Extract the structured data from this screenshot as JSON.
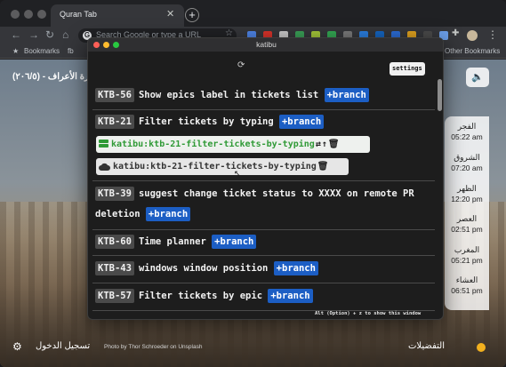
{
  "browser": {
    "tab_title": "Quran Tab",
    "tab_close": "✕",
    "new_tab": "+",
    "omnibox_placeholder": "Search Google or type a URL",
    "omnibox_logo": "G",
    "bookmarks_bar": {
      "label": "Bookmarks",
      "item_short": "fb",
      "other": "Other Bookmarks"
    },
    "nav": {
      "back": "←",
      "forward": "→",
      "reload": "↻",
      "home": "⌂",
      "star": "☆",
      "extensions": "puzzle-icon",
      "menu": "⋮"
    }
  },
  "quran_page": {
    "surah_title": "سورة الأعراف - (٢٠٦/٥)",
    "sound_icon": "speaker-icon",
    "prayers": [
      {
        "name": "الفجر",
        "time": "05:22 am"
      },
      {
        "name": "الشروق",
        "time": "07:20 am"
      },
      {
        "name": "الظهر",
        "time": "12:20 pm"
      },
      {
        "name": "العصر",
        "time": "02:51 pm"
      },
      {
        "name": "المغرب",
        "time": "05:21 pm"
      },
      {
        "name": "العشاء",
        "time": "06:51 pm"
      }
    ],
    "login_label": "تسجيل الدخول",
    "settings_label": "التفضيلات",
    "photo_credit": "Photo by Thor Schroeder on Unsplash"
  },
  "katibu": {
    "window_title": "katibu",
    "settings_label": "settings",
    "spinner": "⟳",
    "branch_button_label": "+branch",
    "hint": "Alt (Option) + z  to show this window",
    "tickets": [
      {
        "key": "KTB-56",
        "title": "Show epics label in tickets list"
      },
      {
        "key": "KTB-21",
        "title": "Filter tickets by typing",
        "branches": [
          {
            "kind": "local",
            "prefix": "katibu:",
            "name": "ktb-21-filter-tickets-by-typing",
            "actions": [
              "⇄",
              "↑",
              "🗑"
            ]
          },
          {
            "kind": "remote",
            "prefix": "katibu:",
            "name": "ktb-21-filter-tickets-by-typing",
            "actions": [
              "🗑"
            ]
          }
        ]
      },
      {
        "key": "KTB-39",
        "title": "suggest change ticket status to XXXX on remote PR",
        "title_line2": "deletion"
      },
      {
        "key": "KTB-60",
        "title": "Time planner"
      },
      {
        "key": "KTB-43",
        "title": "windows window position"
      },
      {
        "key": "KTB-57",
        "title": "Filter tickets by epic"
      }
    ]
  }
}
